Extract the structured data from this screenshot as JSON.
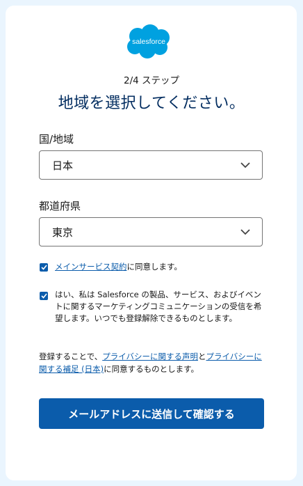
{
  "brand": {
    "name": "salesforce",
    "color": "#00a1e0"
  },
  "step": "2/4 ステップ",
  "title": "地域を選択してください。",
  "country": {
    "label": "国/地域",
    "value": "日本"
  },
  "prefecture": {
    "label": "都道府県",
    "value": "東京"
  },
  "agreement1": {
    "checked": true,
    "link_text": "メインサービス契約",
    "suffix": "に同意します。"
  },
  "agreement2": {
    "checked": true,
    "text": "はい、私は Salesforce の製品、サービス、およびイベントに関するマーケティングコミュニケーションの受信を希望します。いつでも登録解除できるものとします。"
  },
  "legal": {
    "prefix": "登録することで、",
    "link1": "プライバシーに関する声明",
    "middle": "と",
    "link2": "プライバシーに関する補足 (日本)",
    "suffix": "に同意するものとします。"
  },
  "submit_label": "メールアドレスに送信して確認する",
  "colors": {
    "primary": "#0b5cab",
    "title": "#032d60",
    "background": "#eaf5fe"
  }
}
